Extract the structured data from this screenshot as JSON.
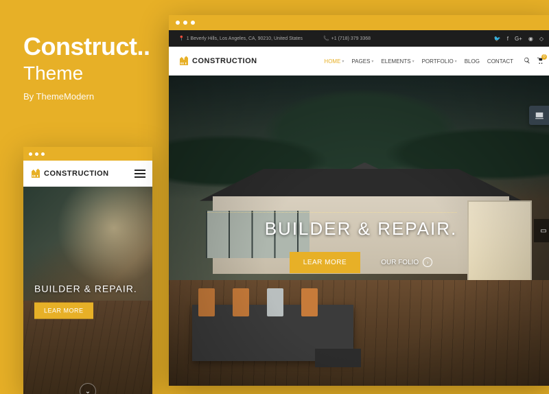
{
  "promo": {
    "title": "Construct..",
    "subtitle": "Theme",
    "byline": "By ThemeModern"
  },
  "brand": {
    "name": "CONSTRUCTION",
    "accent": "#e7b027"
  },
  "topbar": {
    "address": "1 Beverly Hills, Los Angeles, CA, 90210, United States",
    "phone": "+1 (718) 379 3368"
  },
  "social": [
    "twitter",
    "facebook",
    "google-plus",
    "pinterest",
    "instagram"
  ],
  "nav": {
    "items": [
      {
        "label": "HOME",
        "dropdown": true,
        "active": true
      },
      {
        "label": "PAGES",
        "dropdown": true,
        "active": false
      },
      {
        "label": "ELEMENTS",
        "dropdown": true,
        "active": false
      },
      {
        "label": "PORTFOLIO",
        "dropdown": true,
        "active": false
      },
      {
        "label": "BLOG",
        "dropdown": false,
        "active": false
      },
      {
        "label": "CONTACT",
        "dropdown": false,
        "active": false
      }
    ],
    "cart_count": "0"
  },
  "hero": {
    "heading": "BUILDER & REPAIR.",
    "cta_primary": "LEAR MORE",
    "cta_secondary": "OUR FOLIO"
  },
  "mobile_hero": {
    "heading": "BUILDER & REPAIR.",
    "cta": "LEAR MORE"
  }
}
